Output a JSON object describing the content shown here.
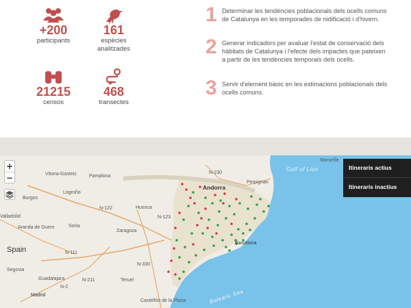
{
  "stats": [
    {
      "icon": "people-icon",
      "value": "+200",
      "label": "participants"
    },
    {
      "icon": "bird-icon",
      "value": "161",
      "label": "espècies analitzades"
    },
    {
      "icon": "binoculars-icon",
      "value": "21215",
      "label": "censos"
    },
    {
      "icon": "route-icon",
      "value": "468",
      "label": "transectes"
    }
  ],
  "goals": [
    {
      "number": "1",
      "text": "Determinar les tendències poblacionals dels ocells comuns de Catalunya en les temporades de nidificació i d'hivern."
    },
    {
      "number": "2",
      "text": "Generar indicadors per avaluar l'estat de conservació dels hàbitats de Catalunya i l'efecte dels impactes que pateixen a partir de les tendències temporals dels ocells."
    },
    {
      "number": "3",
      "text": "Servir d'element bàsic en les estimacions poblacionals dels ocells comuns."
    }
  ],
  "map": {
    "zoom_in": "+",
    "zoom_out": "−",
    "legend": {
      "active": "Itineraris actius",
      "inactive": "Itineraris inactius"
    },
    "labels": {
      "andorra": "Andorra",
      "spain": "Spain",
      "barcelona": "Barcelona",
      "madrid": "Madrid",
      "vitoria": "Vitoria-Gasteiz",
      "pamplona": "Pamplona",
      "logrono": "Logroño",
      "burgos": "Burgos",
      "soria": "Soria",
      "huesca": "Huesca",
      "zaragoza": "Zaragoza",
      "perpignan": "Perpignan",
      "marseille": "Marseille",
      "valladolid": "Valladolid",
      "segovia": "Segovia",
      "guadalajara": "Guadalajara",
      "teruel": "Teruel",
      "castellon": "Castellón de la Plana",
      "aranda": "Aranda de Duero",
      "gulf_of_lion": "Gulf of Lion",
      "balearic_sea": "Balearic Sea",
      "n230": "N-230",
      "n123": "N-123",
      "n111": "N-111",
      "n122": "N-122",
      "n330": "N-330",
      "n211": "N-211",
      "n2": "N-2"
    }
  },
  "colors": {
    "accent": "#c0504d",
    "goal_number": "#e8a39e",
    "active_dot": "#2ea043",
    "inactive_dot": "#d43c3c",
    "sea": "#79c3ea",
    "legend_bg": "#1f1f1f"
  }
}
